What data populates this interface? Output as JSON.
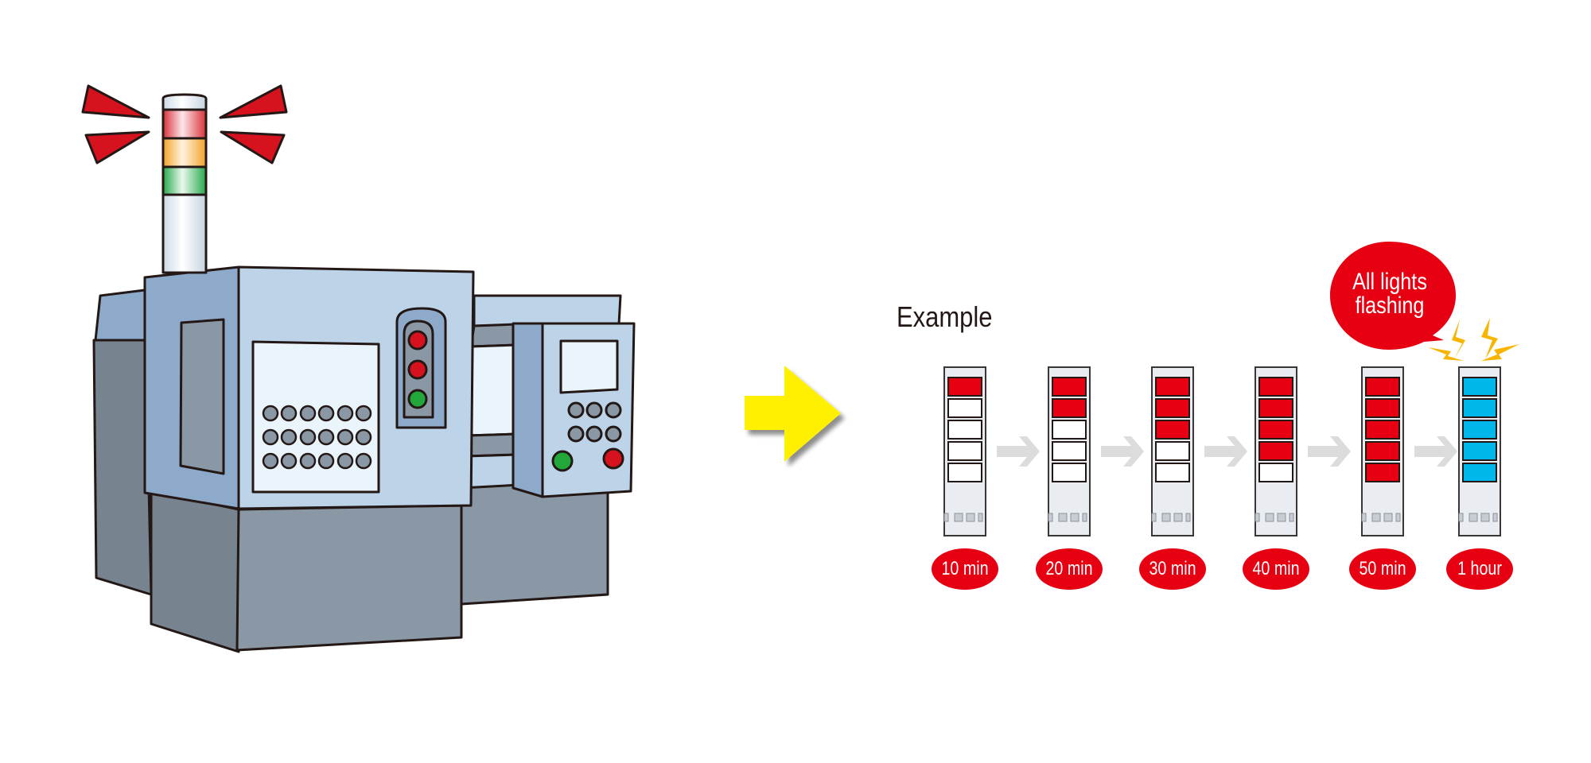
{
  "title": "Example",
  "callout": {
    "line1": "All lights",
    "line2": "flashing"
  },
  "colors": {
    "alarm_red": "#e60012",
    "flash_blue": "#00b7ec",
    "spark_yellow": "#f7b500",
    "arrow_yellow": "#fff000",
    "machine_light": "#bcd3e8",
    "machine_mid": "#8eaacb",
    "machine_dark": "#77838f",
    "machine_gray": "#8a98a5",
    "panel_white": "#eaf4fb"
  },
  "machine": {
    "signal_tower_tiers": [
      "red",
      "amber",
      "green"
    ],
    "front_lamps": [
      "red",
      "red",
      "green"
    ],
    "side_buttons": [
      "green",
      "red"
    ]
  },
  "steps": [
    {
      "label": "10 min",
      "lit": 1,
      "color": "red"
    },
    {
      "label": "20 min",
      "lit": 2,
      "color": "red"
    },
    {
      "label": "30 min",
      "lit": 3,
      "color": "red"
    },
    {
      "label": "40 min",
      "lit": 4,
      "color": "red"
    },
    {
      "label": "50 min",
      "lit": 5,
      "color": "red"
    },
    {
      "label": "1 hour",
      "lit": 5,
      "color": "blue",
      "flashing": true
    }
  ]
}
